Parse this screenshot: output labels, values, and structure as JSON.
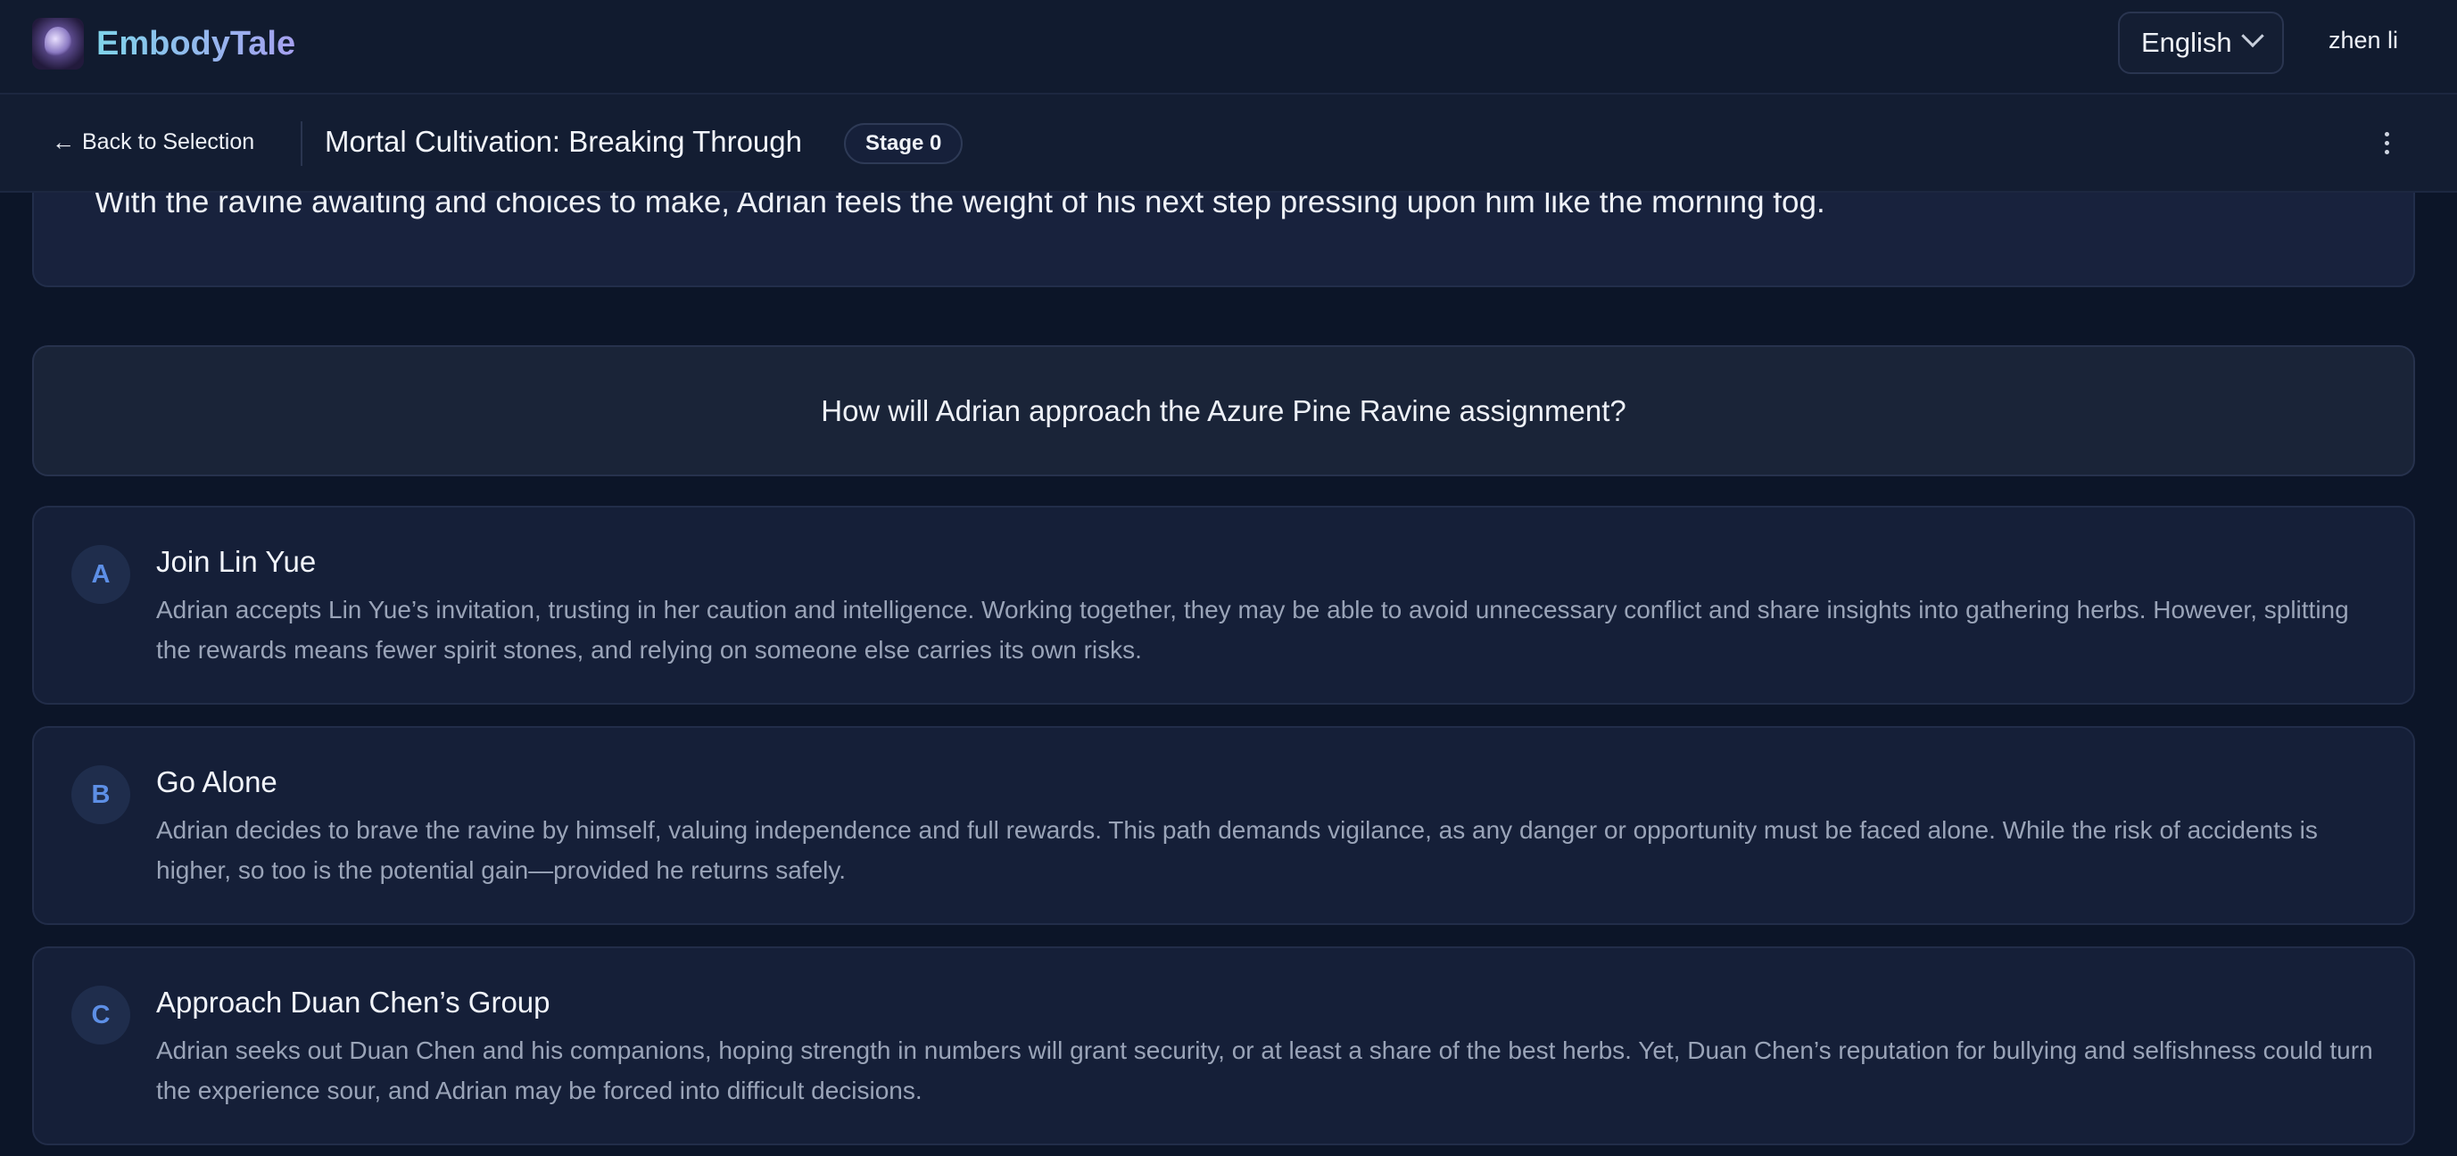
{
  "app": {
    "name": "EmbodyTale",
    "logo_icon": "cosmic-face-logo-icon",
    "accent_gradient": [
      "#7fd3ea",
      "#a6a0f0"
    ]
  },
  "header": {
    "language": "English",
    "user": "zhen li"
  },
  "story_bar": {
    "back_label": "Back to Selection",
    "back_icon": "arrow-left-icon",
    "title": "Mortal Cultivation: Breaking Through",
    "stage": "Stage 0",
    "more_icon": "vertical-ellipsis-icon"
  },
  "narrative": {
    "text": "With the ravine awaiting and choices to make, Adrian feels the weight of his next step pressing upon him like the morning fog."
  },
  "question": "How will Adrian approach the Azure Pine Ravine assignment?",
  "choices": [
    {
      "letter": "A",
      "title": "Join Lin Yue",
      "description": "Adrian accepts Lin Yue’s invitation, trusting in her caution and intelligence. Working together, they may be able to avoid unnecessary conflict and share insights into gathering herbs. However, splitting the rewards means fewer spirit stones, and relying on someone else carries its own risks."
    },
    {
      "letter": "B",
      "title": "Go Alone",
      "description": "Adrian decides to brave the ravine by himself, valuing independence and full rewards. This path demands vigilance, as any danger or opportunity must be faced alone. While the risk of accidents is higher, so too is the potential gain—provided he returns safely."
    },
    {
      "letter": "C",
      "title": "Approach Duan Chen’s Group",
      "description": "Adrian seeks out Duan Chen and his companions, hoping strength in numbers will grant security, or at least a share of the best herbs. Yet, Duan Chen’s reputation for bullying and selfishness could turn the experience sour, and Adrian may be forced into difficult decisions."
    }
  ]
}
